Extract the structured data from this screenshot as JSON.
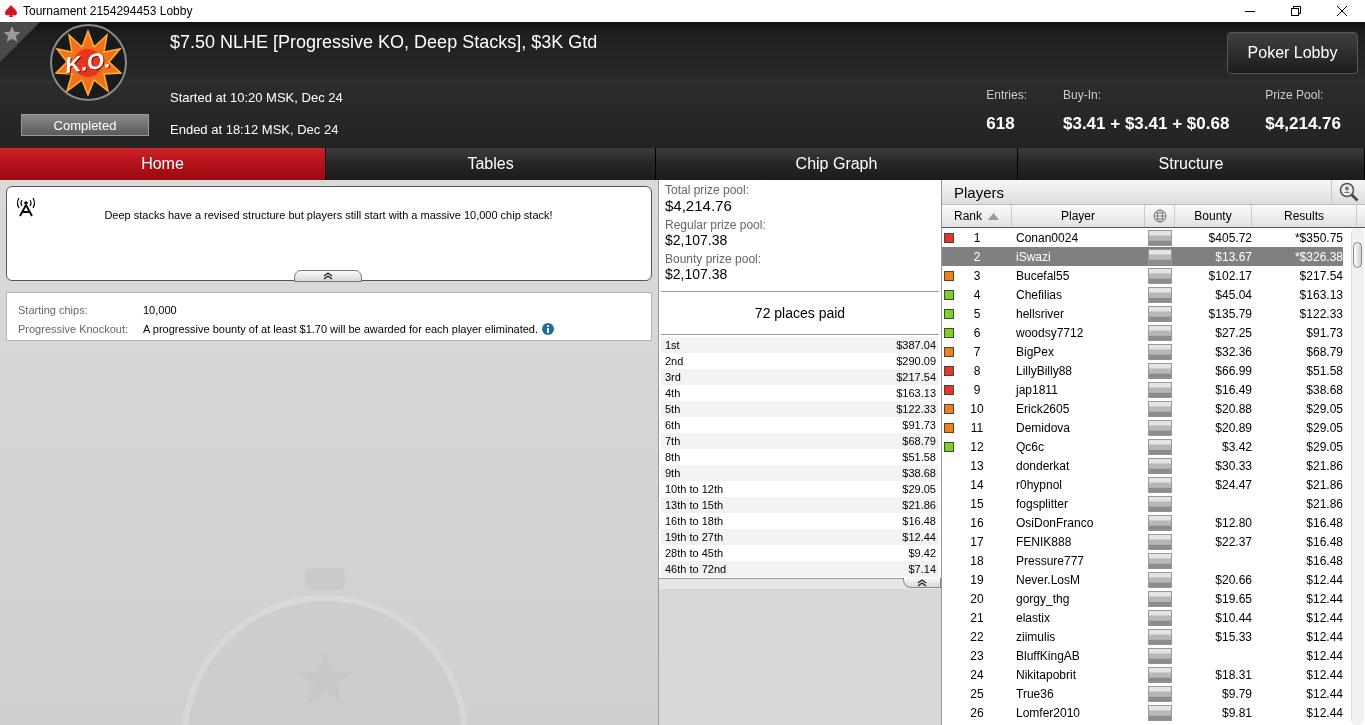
{
  "window": {
    "title": "Tournament 2154294453 Lobby"
  },
  "header": {
    "logo_text": "K.O.",
    "status": "Completed",
    "title": "$7.50 NLHE [Progressive KO, Deep Stacks], $3K Gtd",
    "started": "Started at 10:20 MSK, Dec 24",
    "ended": "Ended at 18:12 MSK, Dec 24",
    "button": "Poker Lobby",
    "stats": [
      {
        "label": "Entries:",
        "value": "618"
      },
      {
        "label": "Buy-In:",
        "value": "$3.41 + $3.41 + $0.68"
      },
      {
        "label": "Prize Pool:",
        "value": "$4,214.76"
      }
    ]
  },
  "tabs": [
    {
      "label": "Home",
      "selected": true
    },
    {
      "label": "Tables",
      "selected": false
    },
    {
      "label": "Chip Graph",
      "selected": false
    },
    {
      "label": "Structure",
      "selected": false
    }
  ],
  "home": {
    "notice": "Deep stacks have a revised structure but players still start with a massive 10,000 chip stack!",
    "details": [
      {
        "label": "Starting chips:",
        "value": "10,000",
        "info": false
      },
      {
        "label": "Progressive Knockout:",
        "value": "A progressive bounty of at least $1.70 will be awarded for each player eliminated.",
        "info": true
      }
    ]
  },
  "prizes": {
    "pools": [
      {
        "label": "Total prize pool:",
        "value": "$4,214.76",
        "kind": "main"
      },
      {
        "label": "Regular prize pool:",
        "value": "$2,107.38",
        "kind": "sub"
      },
      {
        "label": "Bounty prize pool:",
        "value": "$2,107.38",
        "kind": "sub"
      }
    ],
    "places_paid": "72 places paid",
    "payouts": [
      {
        "place": "1st",
        "amount": "$387.04"
      },
      {
        "place": "2nd",
        "amount": "$290.09"
      },
      {
        "place": "3rd",
        "amount": "$217.54"
      },
      {
        "place": "4th",
        "amount": "$163.13"
      },
      {
        "place": "5th",
        "amount": "$122.33"
      },
      {
        "place": "6th",
        "amount": "$91.73"
      },
      {
        "place": "7th",
        "amount": "$68.79"
      },
      {
        "place": "8th",
        "amount": "$51.58"
      },
      {
        "place": "9th",
        "amount": "$38.68"
      },
      {
        "place": "10th to 12th",
        "amount": "$29.05"
      },
      {
        "place": "13th to 15th",
        "amount": "$21.86"
      },
      {
        "place": "16th to 18th",
        "amount": "$16.48"
      },
      {
        "place": "19th to 27th",
        "amount": "$12.44"
      },
      {
        "place": "28th to 45th",
        "amount": "$9.42"
      },
      {
        "place": "46th to 72nd",
        "amount": "$7.14"
      }
    ]
  },
  "players": {
    "title": "Players",
    "columns": [
      "Rank",
      "Player",
      "Bounty",
      "Results"
    ],
    "rows": [
      {
        "rank": "1",
        "player": "Conan0024",
        "bounty": "$405.72",
        "results": "*$350.75",
        "selected": false,
        "color": "#e8372a"
      },
      {
        "rank": "2",
        "player": "iSwazi",
        "bounty": "$13.67",
        "results": "*$326.38",
        "selected": true
      },
      {
        "rank": "3",
        "player": "Bucefal55",
        "bounty": "$102.17",
        "results": "$217.54",
        "selected": false,
        "color": "#f07f1a"
      },
      {
        "rank": "4",
        "player": "Chefilias",
        "bounty": "$45.04",
        "results": "$163.13",
        "selected": false,
        "color": "#7ed321"
      },
      {
        "rank": "5",
        "player": "hellsriver",
        "bounty": "$135.79",
        "results": "$122.33",
        "selected": false,
        "color": "#7ed321"
      },
      {
        "rank": "6",
        "player": "woodsy7712",
        "bounty": "$27.25",
        "results": "$91.73",
        "selected": false,
        "color": "#7ed321"
      },
      {
        "rank": "7",
        "player": "BigPex",
        "bounty": "$32.36",
        "results": "$68.79",
        "selected": false,
        "color": "#f07f1a"
      },
      {
        "rank": "8",
        "player": "LillyBilly88",
        "bounty": "$66.99",
        "results": "$51.58",
        "selected": false,
        "color": "#e8372a"
      },
      {
        "rank": "9",
        "player": "jap1811",
        "bounty": "$16.49",
        "results": "$38.68",
        "selected": false,
        "color": "#e8372a"
      },
      {
        "rank": "10",
        "player": "Erick2605",
        "bounty": "$20.88",
        "results": "$29.05",
        "selected": false,
        "color": "#f07f1a"
      },
      {
        "rank": "11",
        "player": "Demidova",
        "bounty": "$20.89",
        "results": "$29.05",
        "selected": false,
        "color": "#f07f1a"
      },
      {
        "rank": "12",
        "player": "Qc6c",
        "bounty": "$3.42",
        "results": "$29.05",
        "selected": false,
        "color": "#7ed321"
      },
      {
        "rank": "13",
        "player": "donderkat",
        "bounty": "$30.33",
        "results": "$21.86",
        "selected": false
      },
      {
        "rank": "14",
        "player": "r0hypnol",
        "bounty": "$24.47",
        "results": "$21.86",
        "selected": false
      },
      {
        "rank": "15",
        "player": "fogsplitter",
        "results": "$21.86",
        "selected": false
      },
      {
        "rank": "16",
        "player": "OsiDonFranco",
        "bounty": "$12.80",
        "results": "$16.48",
        "selected": false
      },
      {
        "rank": "17",
        "player": "FENIK888",
        "bounty": "$22.37",
        "results": "$16.48",
        "selected": false
      },
      {
        "rank": "18",
        "player": "Pressure777",
        "results": "$16.48",
        "selected": false
      },
      {
        "rank": "19",
        "player": "Never.LosM",
        "bounty": "$20.66",
        "results": "$12.44",
        "selected": false
      },
      {
        "rank": "20",
        "player": "gorgy_thg",
        "bounty": "$19.65",
        "results": "$12.44",
        "selected": false
      },
      {
        "rank": "21",
        "player": "elastix",
        "bounty": "$10.44",
        "results": "$12.44",
        "selected": false
      },
      {
        "rank": "22",
        "player": "ziimulis",
        "bounty": "$15.33",
        "results": "$12.44",
        "selected": false
      },
      {
        "rank": "23",
        "player": "BluffKingAB",
        "results": "$12.44",
        "selected": false
      },
      {
        "rank": "24",
        "player": "Nikitapobrit",
        "bounty": "$18.31",
        "results": "$12.44",
        "selected": false
      },
      {
        "rank": "25",
        "player": "True36",
        "bounty": "$9.79",
        "results": "$12.44",
        "selected": false
      },
      {
        "rank": "26",
        "player": "Lomfer2010",
        "bounty": "$9.81",
        "results": "$12.44",
        "selected": false
      }
    ]
  }
}
